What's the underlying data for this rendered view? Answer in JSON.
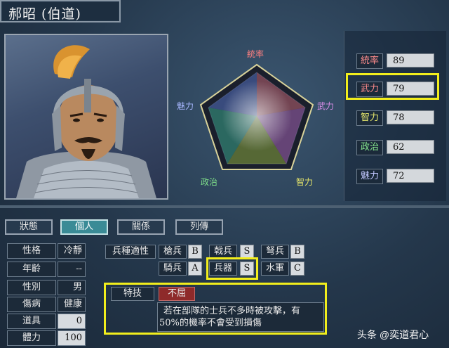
{
  "officer": {
    "name": "郝昭 (伯道)"
  },
  "radar": {
    "labels": {
      "lead": "統率",
      "war": "武力",
      "intel": "智力",
      "pol": "政治",
      "charm": "魅力"
    },
    "colors": {
      "lead": "#ff8080",
      "war": "#d78ce6",
      "intel": "#e5e56a",
      "pol": "#7fe08a",
      "charm": "#a8b8ff"
    }
  },
  "stats": [
    {
      "label": "統率",
      "value": "89",
      "color": "#ff8c8c"
    },
    {
      "label": "武力",
      "value": "79",
      "color": "#ff8c8c"
    },
    {
      "label": "智力",
      "value": "78",
      "color": "#ecec6e"
    },
    {
      "label": "政治",
      "value": "62",
      "color": "#86e68e"
    },
    {
      "label": "魅力",
      "value": "72",
      "color": "#c2c8ff"
    }
  ],
  "tabs": [
    {
      "label": "狀態",
      "active": false
    },
    {
      "label": "個人",
      "active": true
    },
    {
      "label": "關係",
      "active": false
    },
    {
      "label": "列傳",
      "active": false
    }
  ],
  "personal": [
    {
      "label": "性格",
      "value": "冷靜",
      "light": false
    },
    {
      "label": "年齡",
      "value": "--",
      "light": false
    },
    {
      "label": "性別",
      "value": "男",
      "light": false
    },
    {
      "label": "傷病",
      "value": "健康",
      "light": false
    },
    {
      "label": "道具",
      "value": "0",
      "light": true
    },
    {
      "label": "體力",
      "value": "100",
      "light": true
    }
  ],
  "aptitude": {
    "title": "兵種適性",
    "items": [
      {
        "label": "槍兵",
        "grade": "B"
      },
      {
        "label": "戟兵",
        "grade": "S"
      },
      {
        "label": "弩兵",
        "grade": "B"
      },
      {
        "label": "騎兵",
        "grade": "A"
      },
      {
        "label": "兵器",
        "grade": "S"
      },
      {
        "label": "水軍",
        "grade": "C"
      }
    ]
  },
  "skill": {
    "title": "特技",
    "name": "不屈",
    "desc_line1": "若在部隊的士兵不多時被攻擊，有",
    "desc_line2": "50%的機率不會受到損傷"
  },
  "watermark": "头条 @奕道君心"
}
